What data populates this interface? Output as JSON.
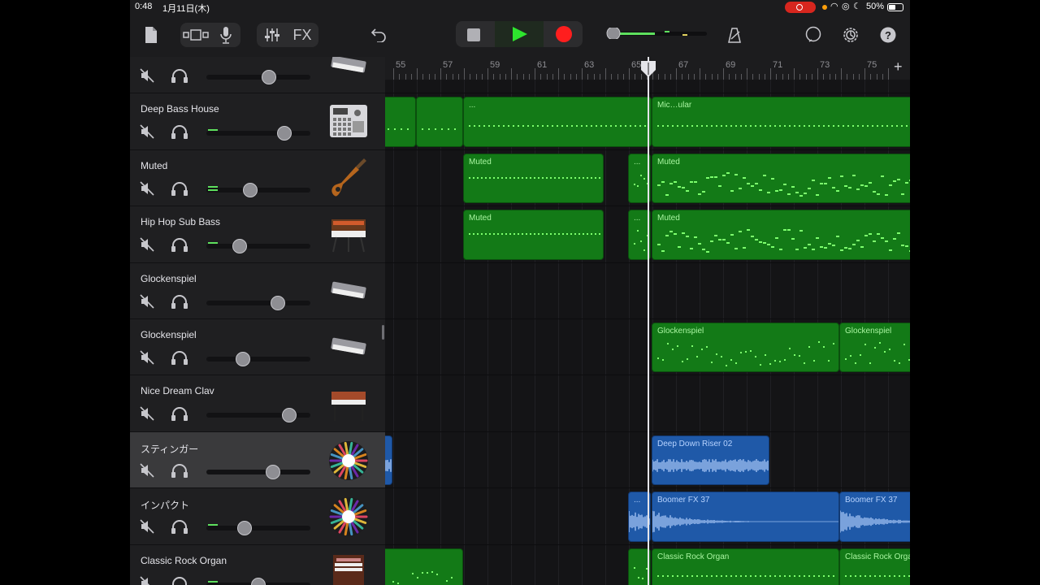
{
  "status": {
    "time": "0:48",
    "date": "1月11日(木)",
    "battery": "50%"
  },
  "toolbar": {
    "fx_label": "FX"
  },
  "ruler": {
    "bars": [
      "55",
      "57",
      "59",
      "61",
      "63",
      "65",
      "67",
      "69",
      "71",
      "73",
      "75"
    ],
    "add_label": "+"
  },
  "tracks": [
    {
      "name": "",
      "instrument": "keyboard"
    },
    {
      "name": "Deep Bass House",
      "instrument": "drum-machine"
    },
    {
      "name": "Muted",
      "instrument": "bass-guitar"
    },
    {
      "name": "Hip Hop Sub Bass",
      "instrument": "synth"
    },
    {
      "name": "Glockenspiel",
      "instrument": "keyboard"
    },
    {
      "name": "Glockenspiel",
      "instrument": "keyboard"
    },
    {
      "name": "Nice Dream Clav",
      "instrument": "clav"
    },
    {
      "name": "スティンガー",
      "instrument": "fx-burst"
    },
    {
      "name": "インパクト",
      "instrument": "fx-burst"
    },
    {
      "name": "Classic Rock Organ",
      "instrument": "organ"
    }
  ],
  "volumes": [
    0.6,
    0.75,
    0.42,
    0.32,
    0.69,
    0.35,
    0.8,
    0.64,
    0.37,
    0.5
  ],
  "regions": {
    "r1a": "...",
    "r1b": "Mic…ular",
    "r2a": "Muted",
    "r2b": "...",
    "r2c": "Muted",
    "r3a": "Muted",
    "r3b": "...",
    "r3c": "Muted",
    "r5a": "Glockenspiel",
    "r5b": "Glockenspiel",
    "r7a": "Deep Down Riser 02",
    "r8a": "...",
    "r8b": "Boomer FX 37",
    "r8c": "Boomer FX 37",
    "r9a": "Classic Rock Organ",
    "r9b": "Classic Rock Organ"
  },
  "colors": {
    "midi": "#137a17",
    "audio": "#1f59a8",
    "record": "#ff1e1e",
    "play": "#2ee52e"
  }
}
